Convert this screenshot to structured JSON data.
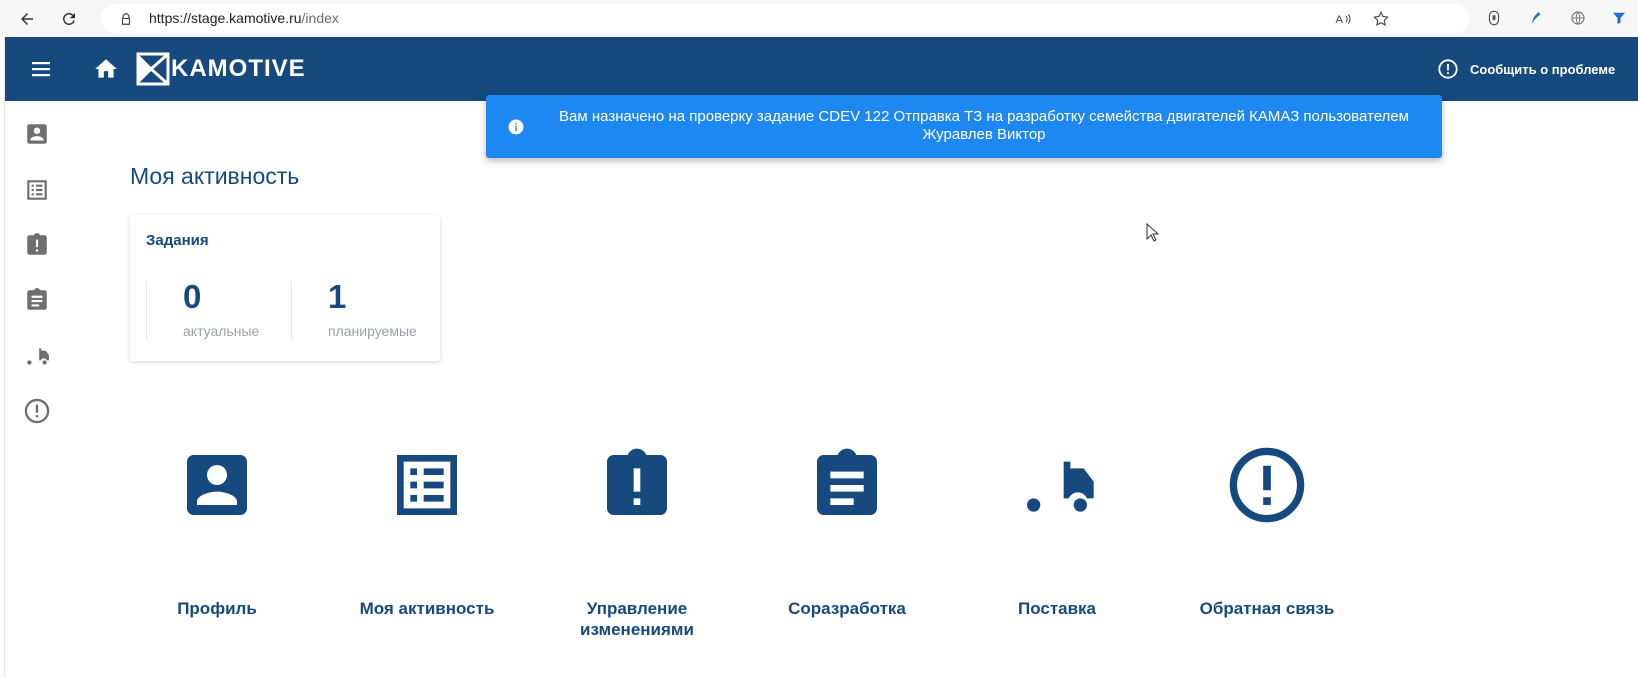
{
  "browser": {
    "url_host": "https://stage.kamotive.ru",
    "url_path": "/index"
  },
  "header": {
    "logo_text": "KAMOTIVE",
    "report_label": "Сообщить о проблеме"
  },
  "toast": {
    "message": "Вам назначено на проверку задание CDEV 122 Отправка ТЗ на разработку семейства двигателей КАМАЗ пользователем Журавлев Виктор"
  },
  "page": {
    "title": "Моя активность"
  },
  "tasks_card": {
    "title": "Задания",
    "stats": [
      {
        "value": "0",
        "label": "актуальные"
      },
      {
        "value": "1",
        "label": "планируемые"
      }
    ]
  },
  "tiles": [
    {
      "label": "Профиль",
      "icon": "account-box-icon"
    },
    {
      "label": "Моя активность",
      "icon": "list-alt-icon"
    },
    {
      "label": "Управление изменениями",
      "icon": "clipboard-alert-icon"
    },
    {
      "label": "Соразработка",
      "icon": "assignment-icon"
    },
    {
      "label": "Поставка",
      "icon": "truck-icon"
    },
    {
      "label": "Обратная связь",
      "icon": "error-outline-icon"
    }
  ],
  "colors": {
    "brand": "#164a7e",
    "toast": "#1e88f2",
    "sidebar_icon": "#6f6f6f"
  }
}
